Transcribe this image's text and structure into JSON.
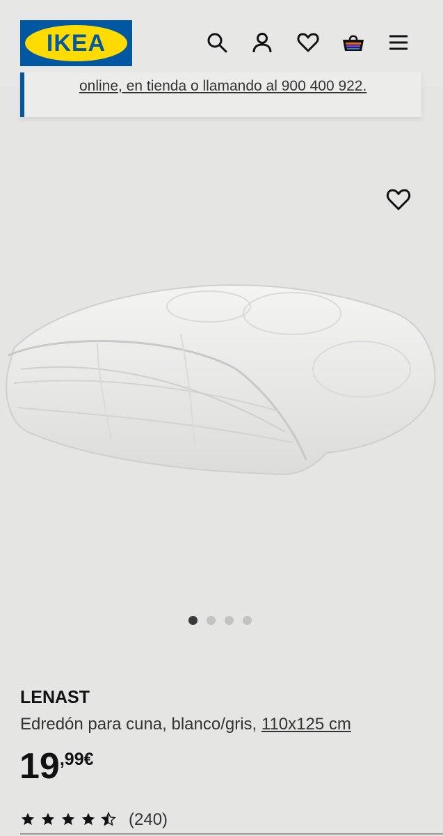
{
  "header": {
    "logo_text": "IKEA",
    "logo_reg": "®",
    "icons": [
      "search-icon",
      "account-icon",
      "heart-icon",
      "cart-icon",
      "menu-icon"
    ]
  },
  "banner": {
    "text": "online, en tienda o llamando al 900 400 922."
  },
  "gallery": {
    "image_count": 4,
    "active_index": 0
  },
  "product": {
    "name": "LENAST",
    "description": "Edredón para cuna, blanco/gris,",
    "size": "110x125 cm",
    "price_integer": "19",
    "price_decimal": ",99€",
    "rating_value": 4.5,
    "rating_max": 5,
    "rating_count": "(240)"
  },
  "colors": {
    "ikea_blue": "#0058a3",
    "ikea_yellow": "#ffdb00"
  }
}
